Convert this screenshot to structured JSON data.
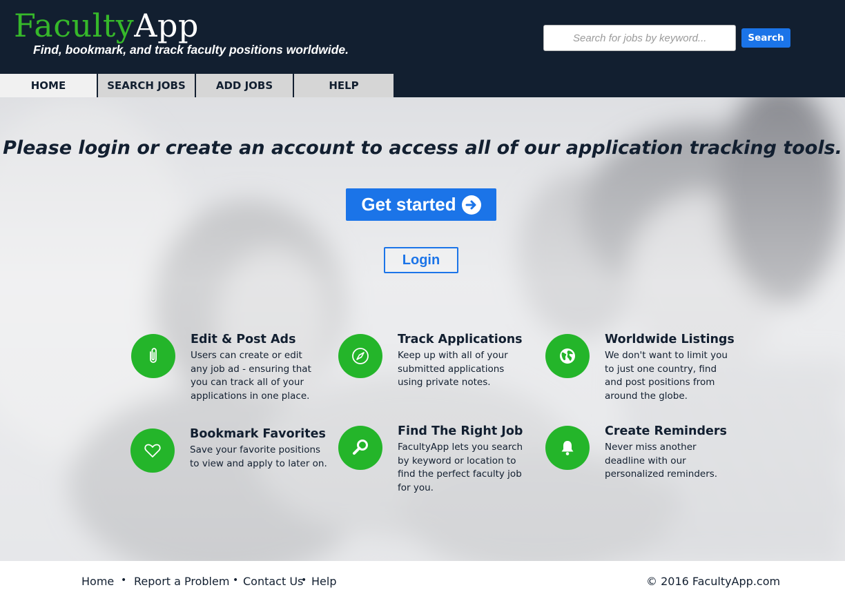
{
  "brand": {
    "logo_part1": "Faculty",
    "logo_part2": "App",
    "tagline": "Find, bookmark, and track faculty positions worldwide."
  },
  "search": {
    "placeholder": "Search for jobs by keyword...",
    "button_label": "Search"
  },
  "nav": {
    "tabs": [
      {
        "label": "HOME",
        "active": true
      },
      {
        "label": "SEARCH JOBS"
      },
      {
        "label": "ADD JOBS"
      },
      {
        "label": "HELP"
      }
    ]
  },
  "hero": {
    "headline": "Please login or create an account to access all of our application tracking tools.",
    "get_started_label": "Get started",
    "login_label": "Login"
  },
  "features": [
    {
      "title": "Edit & Post Ads",
      "description": "Users can create or edit any job ad - ensuring that you can track all of your applications in one place.",
      "icon": "paperclip-icon"
    },
    {
      "title": "Track Applications",
      "description": "Keep up with all of your submitted applications using private notes.",
      "icon": "compass-icon"
    },
    {
      "title": "Worldwide Listings",
      "description": "We don't want to limit you to just one country, find and post positions from around the globe.",
      "icon": "globe-icon"
    },
    {
      "title": "Bookmark Favorites",
      "description": "Save your favorite positions to view and apply to later on.",
      "icon": "heart-icon"
    },
    {
      "title": "Find The Right Job",
      "description": "FacultyApp lets you search by keyword or location to find the perfect faculty job for you.",
      "icon": "magnifier-icon"
    },
    {
      "title": "Create Reminders",
      "description": "Never miss another deadline with our personalized reminders.",
      "icon": "bell-icon"
    }
  ],
  "footer": {
    "links": [
      "Home",
      "Report a Problem",
      "Contact Us",
      "Help"
    ],
    "separator": "•",
    "copyright": "© 2016 FacultyApp.com"
  },
  "colors": {
    "brand_green": "#36b82a",
    "accent_blue": "#1b74e8",
    "header_navy": "#121f30",
    "icon_green": "#24b52a"
  }
}
